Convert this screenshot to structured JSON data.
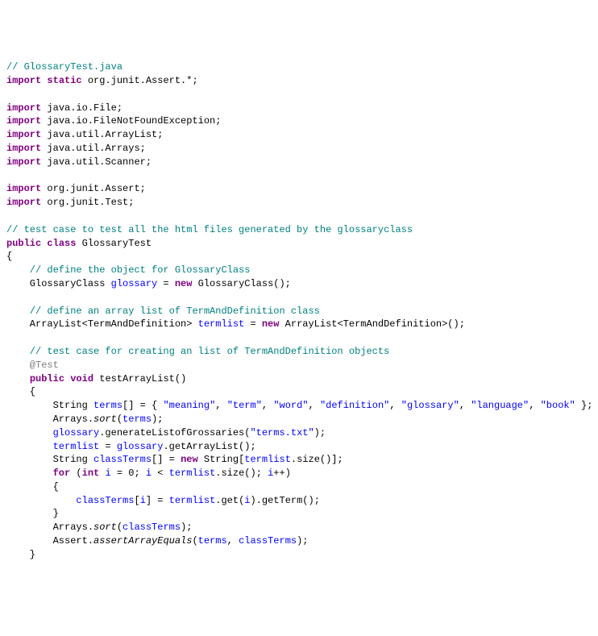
{
  "code": {
    "line1": "// GlossaryTest.java",
    "line2_import": "import",
    "line2_static": "static",
    "line2_pkg": " org.junit.Assert.*;",
    "line3_import": "import",
    "line3_pkg": " java.io.File;",
    "line4_import": "import",
    "line4_pkg": " java.io.FileNotFoundException;",
    "line5_import": "import",
    "line5_pkg": " java.util.ArrayList;",
    "line6_import": "import",
    "line6_pkg": " java.util.Arrays;",
    "line7_import": "import",
    "line7_pkg": " java.util.Scanner;",
    "line8_import": "import",
    "line8_pkg": " org.junit.Assert;",
    "line9_import": "import",
    "line9_pkg": " org.junit.Test;",
    "line10": "// test case to test all the html files generated by the glossaryclass",
    "line11_public": "public",
    "line11_class": "class",
    "line11_name": " GlossaryTest",
    "lbrace": "{",
    "rbrace": "}",
    "line12": "    // define the object for GlossaryClass",
    "line13_a": "    GlossaryClass ",
    "line13_field": "glossary",
    "line13_b": " = ",
    "line13_new": "new",
    "line13_c": " GlossaryClass();",
    "line14": "    // define an array list of TermAndDefinition class",
    "line15_a": "    ArrayList<TermAndDefinition> ",
    "line15_field": "termlist",
    "line15_b": " = ",
    "line15_new": "new",
    "line15_c": " ArrayList<TermAndDefinition>();",
    "line16": "    // test case for creating an list of TermAndDefinition objects",
    "line17": "    @Test",
    "line18_public": "public",
    "line18_void": "void",
    "line18_name": " testArrayList()",
    "line18_pre": "    ",
    "line19": "    {",
    "line20_a": "        String ",
    "line20_var": "terms",
    "line20_b": "[] = { ",
    "line20_s1": "\"meaning\"",
    "line20_s2": "\"term\"",
    "line20_s3": "\"word\"",
    "line20_s4": "\"definition\"",
    "line20_s5": "\"glossary\"",
    "line20_s6": "\"language\"",
    "line20_s7": "\"book\"",
    "line20_c": " };",
    "comma": ", ",
    "line21_a": "        Arrays.",
    "line21_m": "sort",
    "line21_b": "(",
    "line21_var": "terms",
    "line21_c": ");",
    "line22_a": "        ",
    "line22_f": "glossary",
    "line22_b": ".generateListofGrossaries(",
    "line22_s": "\"terms.txt\"",
    "line22_c": ");",
    "line23_a": "        ",
    "line23_f1": "termlist",
    "line23_b": " = ",
    "line23_f2": "glossary",
    "line23_c": ".getArrayList();",
    "line24_a": "        String ",
    "line24_var": "classTerms",
    "line24_b": "[] = ",
    "line24_new": "new",
    "line24_c": " String[",
    "line24_f": "termlist",
    "line24_d": ".size()];",
    "line25_a": "        ",
    "line25_for": "for",
    "line25_b": " (",
    "line25_int": "int",
    "line25_c": " ",
    "line25_v1": "i",
    "line25_d": " = 0; ",
    "line25_v2": "i",
    "line25_e": " < ",
    "line25_f": "termlist",
    "line25_g": ".size(); ",
    "line25_v3": "i",
    "line25_h": "++)",
    "line26": "        {",
    "line27_a": "            ",
    "line27_v1": "classTerms",
    "line27_b": "[",
    "line27_v2": "i",
    "line27_c": "] = ",
    "line27_f": "termlist",
    "line27_d": ".get(",
    "line27_v3": "i",
    "line27_e": ").getTerm();",
    "line28": "        }",
    "line29_a": "        Arrays.",
    "line29_m": "sort",
    "line29_b": "(",
    "line29_v": "classTerms",
    "line29_c": ");",
    "line30_a": "        Assert.",
    "line30_m": "assertArrayEquals",
    "line30_b": "(",
    "line30_v1": "terms",
    "line30_c": ", ",
    "line30_v2": "classTerms",
    "line30_d": ");",
    "line31": "    }"
  }
}
